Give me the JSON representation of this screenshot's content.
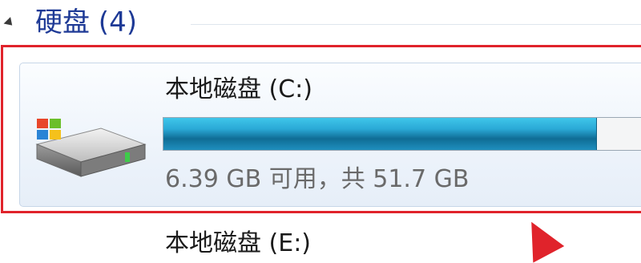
{
  "group": {
    "title": "硬盘 (4)"
  },
  "drives": [
    {
      "name": "本地磁盘 (C:)",
      "space_text": "6.39 GB 可用，共 51.7 GB",
      "used_fraction": 0.876
    },
    {
      "name": "本地磁盘 (E:)"
    }
  ],
  "colors": {
    "highlight": "#e0232b",
    "group_title": "#1e3a96",
    "bar_fill": "#2aa9d6"
  },
  "icons": {
    "collapse": "collapse-triangle-icon",
    "drive": "hard-drive-icon",
    "pointer": "red-arrow-pointer"
  }
}
